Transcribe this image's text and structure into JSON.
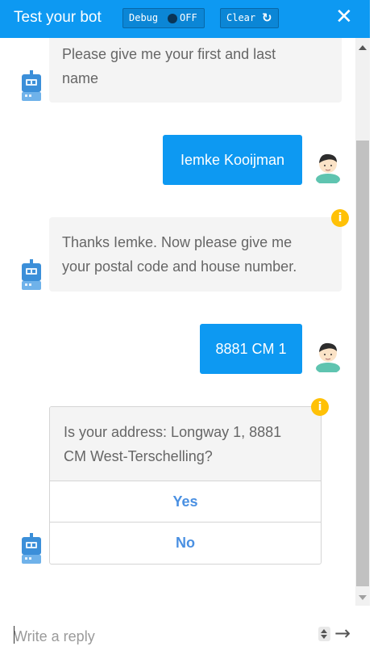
{
  "header": {
    "title": "Test your bot",
    "debug_label": "Debug",
    "debug_state": "OFF",
    "clear_label": "Clear",
    "clear_icon": "refresh-icon",
    "close_icon": "close-icon",
    "colors": {
      "header_bg": "#0d99f2",
      "button_bg": "#0b86d6"
    }
  },
  "messages": [
    {
      "from": "bot",
      "text": "Please give me your first and last name",
      "lines": [
        "Please give me your first and last",
        "name"
      ]
    },
    {
      "from": "user",
      "text": "Iemke Kooijman"
    },
    {
      "from": "bot",
      "text": "Thanks Iemke. Now please give me your postal code and house number.",
      "lines": [
        "Thanks Iemke. Now please give me",
        "your postal code and house number."
      ],
      "info_icon": "info-icon"
    },
    {
      "from": "user",
      "text": "8881 CM 1"
    },
    {
      "from": "bot",
      "type": "choice",
      "question_lines": [
        "Is your address: Longway 1, 8881",
        "CM West-Terschelling?"
      ],
      "options": [
        "Yes",
        "No"
      ],
      "info_icon": "info-icon"
    }
  ],
  "input": {
    "placeholder": "Write a reply",
    "value": "",
    "send_icon": "arrow-right-icon"
  },
  "colors": {
    "user_bubble": "#0d99f2",
    "bot_bubble": "#f4f4f4",
    "info": "#ffc107",
    "option_text": "#4a90e2"
  }
}
